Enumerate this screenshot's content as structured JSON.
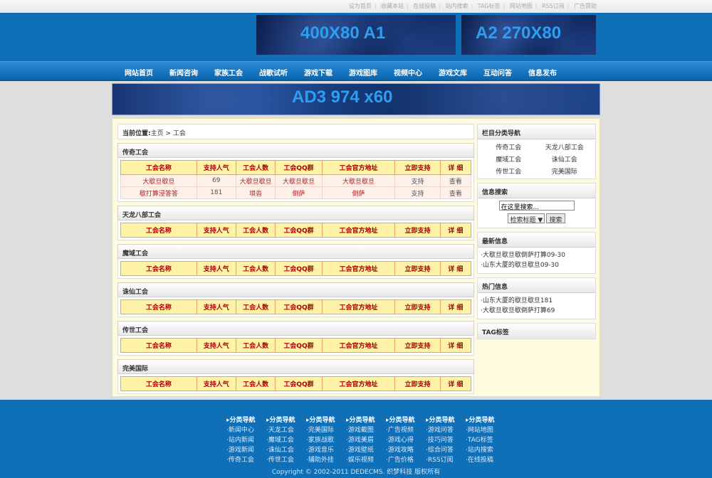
{
  "toplinks": [
    "设为首页",
    "收藏本站",
    "在线投稿",
    "站内搜索",
    "TAG标签",
    "网站地图",
    "RSS订阅",
    "广告赞助"
  ],
  "banners": {
    "a1": "400X80    A1",
    "a2": "A2    270X80",
    "ad3": "AD3  974 x60"
  },
  "nav": [
    "网站首页",
    "新闻咨询",
    "家族工会",
    "战歌试听",
    "游戏下载",
    "游戏图库",
    "视频中心",
    "游戏文库",
    "互动问答",
    "信息发布"
  ],
  "breadcrumb": {
    "prefix": "当前位置:",
    "path": "主页 > 工会"
  },
  "table_headers": [
    "工会名称",
    "支持人气",
    "工会人数",
    "工会QQ群",
    "工会官方地址",
    "立即支持",
    "详 细"
  ],
  "guilds": [
    {
      "title": "传奇工会",
      "rows": [
        [
          "大歇旦歇旦",
          "69",
          "大歇旦歇旦",
          "大歇旦歇旦",
          "大歇旦歇旦",
          "支持",
          "查看"
        ],
        [
          "歇打算浸答答",
          "181",
          "垻沓",
          "倒萨",
          "倒萨",
          "支持",
          "查看"
        ]
      ]
    },
    {
      "title": "天龙八部工会",
      "rows": []
    },
    {
      "title": "魔域工会",
      "rows": []
    },
    {
      "title": "诛仙工会",
      "rows": []
    },
    {
      "title": "传世工会",
      "rows": []
    },
    {
      "title": "完美国际",
      "rows": []
    }
  ],
  "sidebar": {
    "category_title": "栏目分类导航",
    "categories": [
      "传奇工会",
      "天龙八部工会",
      "魔域工会",
      "诛仙工会",
      "传世工会",
      "完美国际"
    ],
    "search_title": "信息搜索",
    "search_value": "在这里搜索...",
    "search_select": "检索标题",
    "search_button": "搜索",
    "latest_title": "最新信息",
    "latest": [
      "·大歇旦歇旦歇倒萨打算09-30",
      "·山东大厦的歇旦歇旦09-30"
    ],
    "hot_title": "热门信息",
    "hot": [
      "·山东大厦的歇旦歇旦181",
      "·大歇旦歇旦歇倒萨打算69"
    ],
    "tag_title": "TAG标签"
  },
  "footer": {
    "columns": [
      [
        "分类导航",
        "新闻中心",
        "站内新闻",
        "游戏新闻",
        "传奇工会"
      ],
      [
        "分类导航",
        "天龙工会",
        "魔域工会",
        "诛仙工会",
        "传世工会"
      ],
      [
        "分类导航",
        "完美国际",
        "家族战歌",
        "游戏音乐",
        "辅助外挂"
      ],
      [
        "分类导航",
        "游戏截图",
        "游戏美眉",
        "游戏壁纸",
        "娱乐视频"
      ],
      [
        "分类导航",
        "广告视频",
        "游戏心得",
        "游戏攻略",
        "广告价格"
      ],
      [
        "分类导航",
        "游戏问答",
        "技巧问答",
        "综合问答",
        "RSS订阅"
      ],
      [
        "分类导航",
        "网站地图",
        "TAG标签",
        "站内搜索",
        "在线投稿"
      ]
    ],
    "copyright": "Copyright © 2002-2011 DEDECMS. 织梦科技 版权所有"
  }
}
